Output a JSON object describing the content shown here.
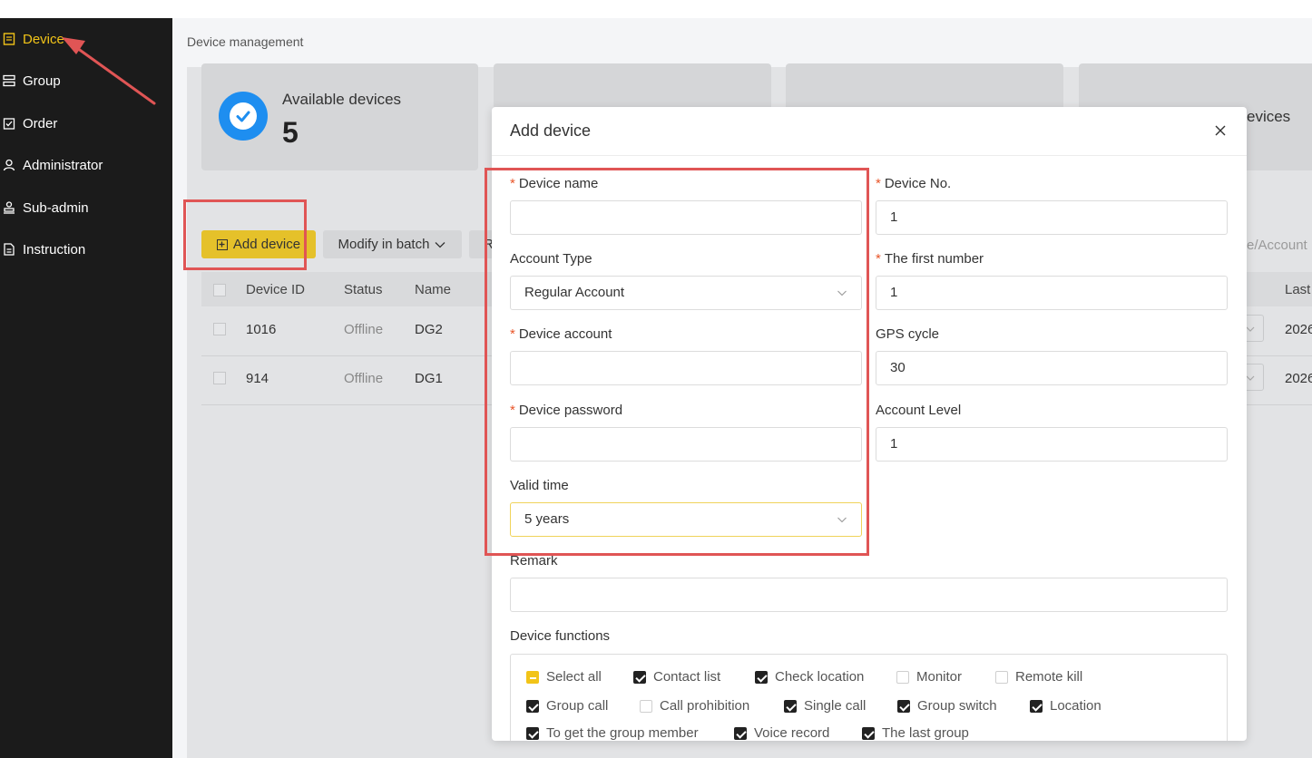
{
  "sidebar": {
    "items": [
      {
        "label": "Device",
        "icon": "document-list-icon",
        "active": true
      },
      {
        "label": "Group",
        "icon": "server-stack-icon"
      },
      {
        "label": "Order",
        "icon": "clipboard-check-icon"
      },
      {
        "label": "Administrator",
        "icon": "user-icon"
      },
      {
        "label": "Sub-admin",
        "icon": "stamp-icon"
      },
      {
        "label": "Instruction",
        "icon": "document-text-icon"
      }
    ]
  },
  "header": {
    "breadcrumb": "Device management"
  },
  "stats": {
    "available_label": "Available devices",
    "available_value": "5",
    "partial_label_right": "evices"
  },
  "toolbar": {
    "add_label": "Add device",
    "batch_label": "Modify in batch",
    "partial_button": "R",
    "search_placeholder_partial": "e/Account"
  },
  "table": {
    "headers": [
      "Device ID",
      "Status",
      "Name",
      "Last"
    ],
    "rows": [
      {
        "id": "1016",
        "status": "Offline",
        "name": "DG2",
        "last": "2026"
      },
      {
        "id": "914",
        "status": "Offline",
        "name": "DG1",
        "last": "2026"
      }
    ]
  },
  "modal": {
    "title": "Add device",
    "left": [
      {
        "label": "Device name",
        "required": true,
        "value": ""
      },
      {
        "label": "Account Type",
        "required": false,
        "value": "Regular Account",
        "select": true
      },
      {
        "label": "Device account",
        "required": true,
        "value": ""
      },
      {
        "label": "Device password",
        "required": true,
        "value": ""
      },
      {
        "label": "Valid time",
        "required": false,
        "value": "5 years",
        "select": true
      }
    ],
    "right": [
      {
        "label": "Device No.",
        "required": true,
        "value": "1"
      },
      {
        "label": "The first number",
        "required": true,
        "value": "1"
      },
      {
        "label": "GPS cycle",
        "required": false,
        "value": "30"
      },
      {
        "label": "Account Level",
        "required": false,
        "value": "1"
      }
    ],
    "remark_label": "Remark",
    "remark_value": "",
    "functions_label": "Device functions",
    "functions": [
      [
        {
          "label": "Select all",
          "state": "partial"
        },
        {
          "label": "Contact list",
          "state": "on"
        },
        {
          "label": "Check location",
          "state": "on"
        },
        {
          "label": "Monitor",
          "state": "off"
        },
        {
          "label": "Remote kill",
          "state": "off"
        }
      ],
      [
        {
          "label": "Group call",
          "state": "on"
        },
        {
          "label": "Call prohibition",
          "state": "off"
        },
        {
          "label": "Single call",
          "state": "on"
        },
        {
          "label": "Group switch",
          "state": "on"
        },
        {
          "label": "Location",
          "state": "on"
        }
      ],
      [
        {
          "label": "To get the group member",
          "state": "on"
        },
        {
          "label": "Voice record",
          "state": "on"
        },
        {
          "label": "The last group",
          "state": "on"
        }
      ]
    ]
  },
  "colors": {
    "accent": "#f2c418",
    "sidebar_bg": "#1b1b1b",
    "annotation_red": "#e05555",
    "stat_icon": "#1e8ef0"
  }
}
